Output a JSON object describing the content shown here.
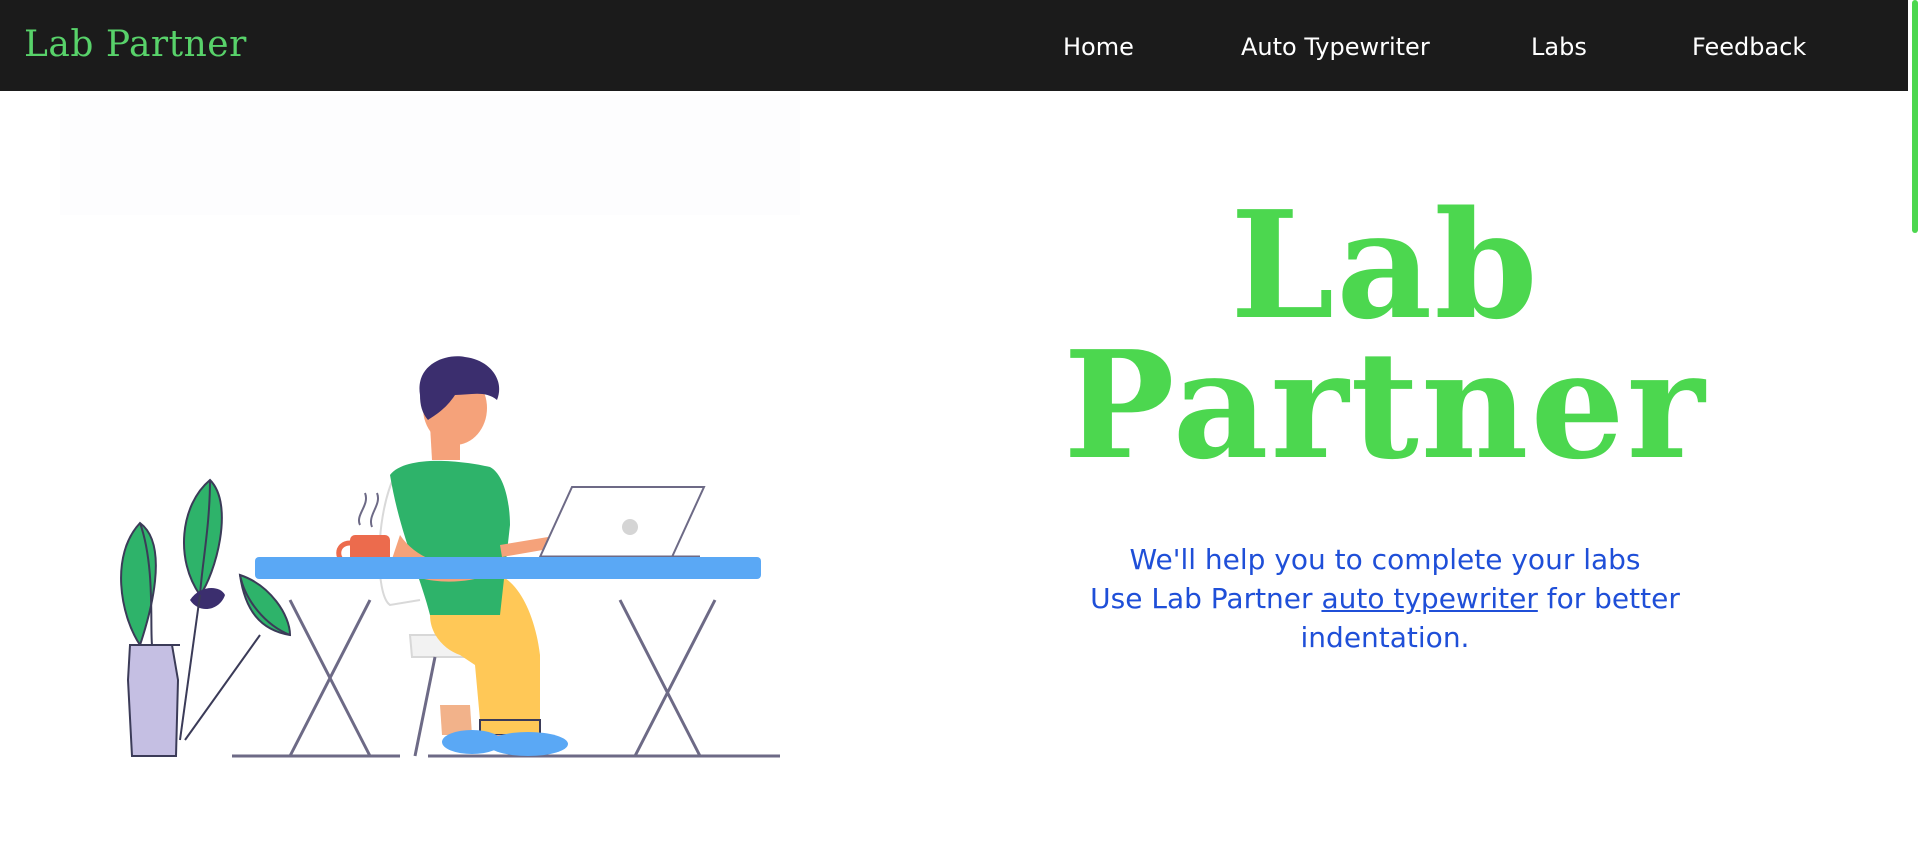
{
  "navbar": {
    "brand": "Lab Partner",
    "links": [
      {
        "label": "Home"
      },
      {
        "label": "Auto Typewriter"
      },
      {
        "label": "Labs"
      },
      {
        "label": "Feedback"
      }
    ]
  },
  "hero": {
    "title_line1": "Lab",
    "title_line2": "Partner",
    "tagline_line1": "We'll help you to complete your labs",
    "tagline_line2_prefix": "Use Lab Partner",
    "tagline_link": "auto typewriter",
    "tagline_line2_suffix": "for better indentation."
  },
  "colors": {
    "navbar_bg": "#1b1b1b",
    "brand": "#58d26a",
    "title": "#4cd74f",
    "tagline": "#1f4fd8",
    "scrollbar_thumb": "#4cd74f"
  },
  "illustration": {
    "subject": "person-working-on-laptop-at-desk",
    "elements": [
      "plant-icon",
      "coffee-mug-icon",
      "laptop-icon",
      "desk",
      "chair"
    ]
  }
}
